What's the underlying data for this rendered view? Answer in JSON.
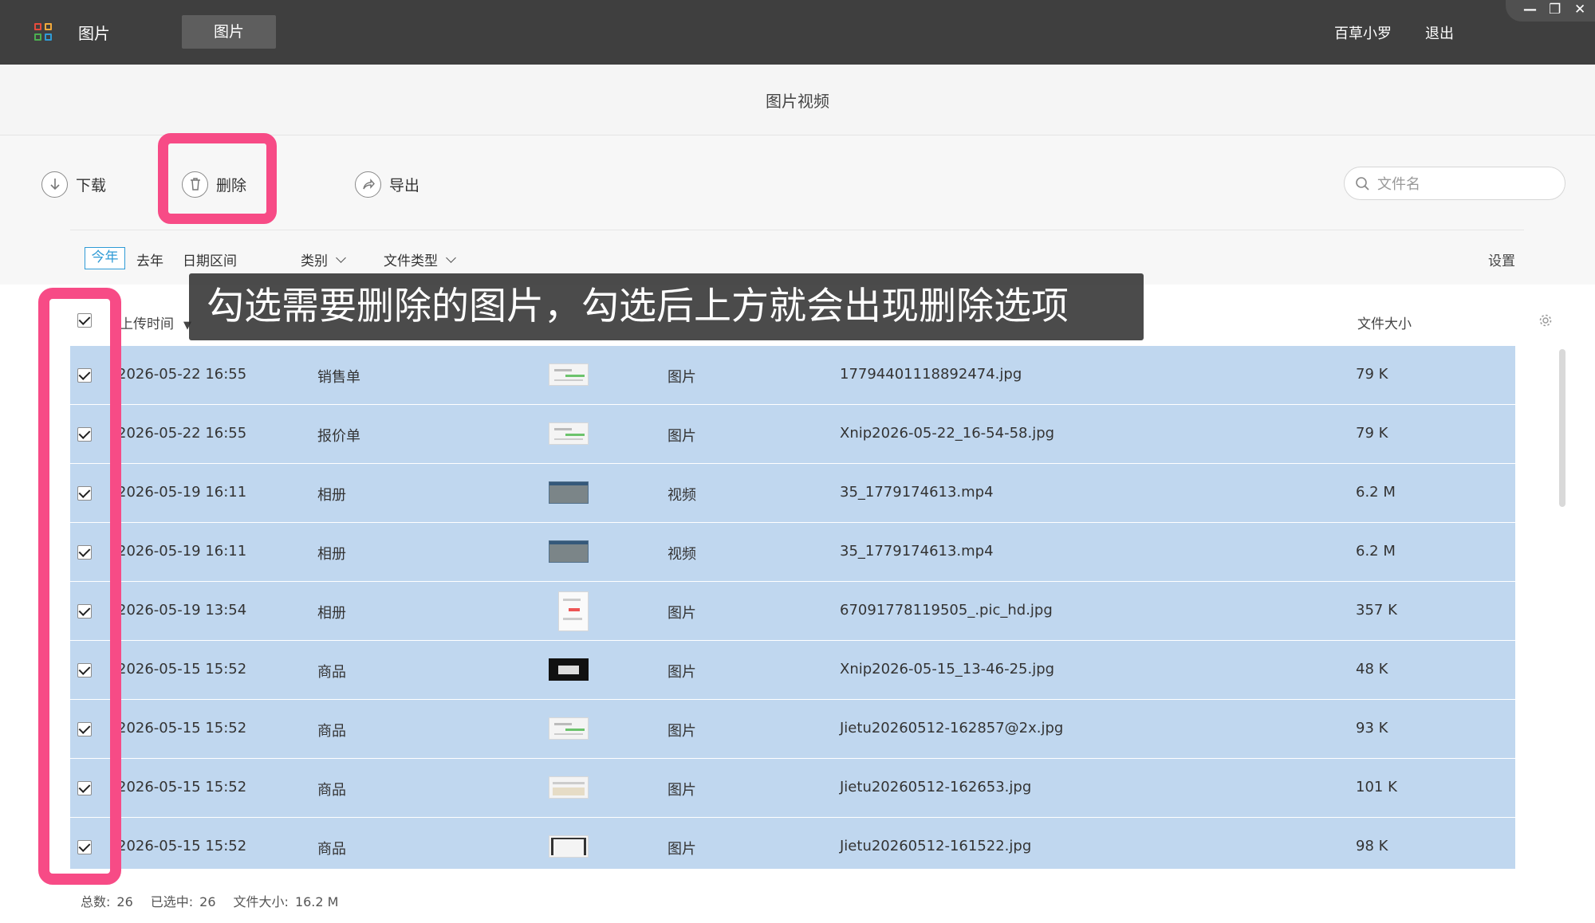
{
  "topbar": {
    "app_title": "图片",
    "active_tab": "图片",
    "user_name": "百草小罗",
    "logout_label": "退出",
    "window_controls": [
      "—",
      "❐",
      "✕"
    ]
  },
  "section": {
    "title": "图片视频"
  },
  "toolbar": {
    "download_label": "下载",
    "delete_label": "删除",
    "export_label": "导出",
    "search_placeholder": "文件名"
  },
  "filters": {
    "this_year": "今年",
    "last_year": "去年",
    "date_range": "日期区间",
    "category": "类别",
    "file_type": "文件类型",
    "settings": "设置"
  },
  "table": {
    "headers": {
      "upload_time": "上传时间",
      "file_size": "文件大小"
    },
    "rows": [
      {
        "time": "2026-05-22 16:55",
        "category": "销售单",
        "type": "图片",
        "filename": "17794401118892474.jpg",
        "size": "79 K",
        "thumb": "doc"
      },
      {
        "time": "2026-05-22 16:55",
        "category": "报价单",
        "type": "图片",
        "filename": "Xnip2026-05-22_16-54-58.jpg",
        "size": "79 K",
        "thumb": "doc"
      },
      {
        "time": "2026-05-19 16:11",
        "category": "相册",
        "type": "视频",
        "filename": "35_1779174613.mp4",
        "size": "6.2 M",
        "thumb": "video"
      },
      {
        "time": "2026-05-19 16:11",
        "category": "相册",
        "type": "视频",
        "filename": "35_1779174613.mp4",
        "size": "6.2 M",
        "thumb": "video"
      },
      {
        "time": "2026-05-19 13:54",
        "category": "相册",
        "type": "图片",
        "filename": "67091778119505_.pic_hd.jpg",
        "size": "357 K",
        "thumb": "tall"
      },
      {
        "time": "2026-05-15 15:52",
        "category": "商品",
        "type": "图片",
        "filename": "Xnip2026-05-15_13-46-25.jpg",
        "size": "48 K",
        "thumb": "dark"
      },
      {
        "time": "2026-05-15 15:52",
        "category": "商品",
        "type": "图片",
        "filename": "Jietu20260512-162857@2x.jpg",
        "size": "93 K",
        "thumb": "doc"
      },
      {
        "time": "2026-05-15 15:52",
        "category": "商品",
        "type": "图片",
        "filename": "Jietu20260512-162653.jpg",
        "size": "101 K",
        "thumb": "grid"
      },
      {
        "time": "2026-05-15 15:52",
        "category": "商品",
        "type": "图片",
        "filename": "Jietu20260512-161522.jpg",
        "size": "98 K",
        "thumb": "frame"
      }
    ]
  },
  "footer": {
    "total_label": "总数:",
    "total_value": "26",
    "selected_label": "已选中:",
    "selected_value": "26",
    "size_label": "文件大小:",
    "size_value": "16.2 M"
  },
  "overlay": {
    "caption": "勾选需要删除的图片，勾选后上方就会出现删除选项"
  },
  "colors": {
    "topbar": "#3f3f3f",
    "row_selected": "#c0d7ef",
    "highlight": "#f74b86",
    "accent": "#2f9bd6"
  }
}
